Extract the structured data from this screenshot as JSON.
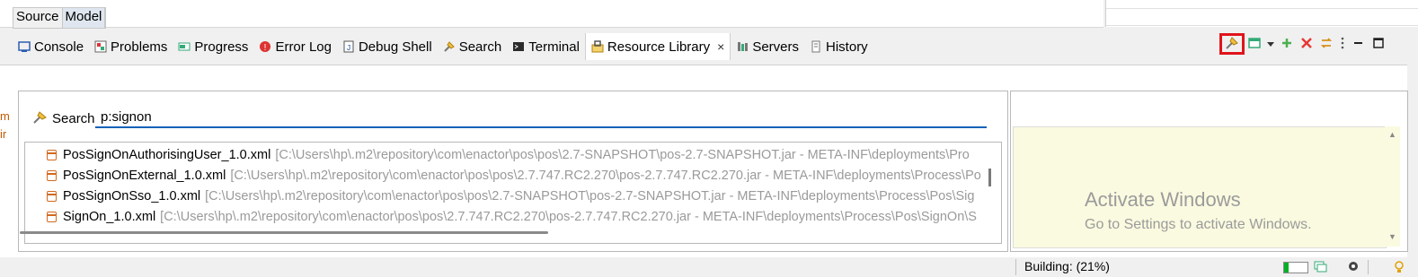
{
  "editor_tabs": {
    "source": "Source",
    "model": "Model"
  },
  "view_tabs": [
    {
      "label": "Console",
      "icon": "console-icon"
    },
    {
      "label": "Problems",
      "icon": "problems-icon"
    },
    {
      "label": "Progress",
      "icon": "progress-icon"
    },
    {
      "label": "Error Log",
      "icon": "error-log-icon"
    },
    {
      "label": "Debug Shell",
      "icon": "debug-shell-icon"
    },
    {
      "label": "Search",
      "icon": "search-icon"
    },
    {
      "label": "Terminal",
      "icon": "terminal-icon"
    },
    {
      "label": "Resource Library",
      "icon": "resource-library-icon",
      "active": true,
      "close": "×"
    },
    {
      "label": "Servers",
      "icon": "servers-icon"
    },
    {
      "label": "History",
      "icon": "history-icon"
    }
  ],
  "toolbar": {
    "buttons": [
      "resource-search-icon",
      "new-window-icon",
      "chevron-down-icon",
      "add-icon",
      "remove-icon",
      "swap-icon",
      "more-icon",
      "minimize-icon",
      "maximize-icon"
    ],
    "highlight_color": "#e0141b"
  },
  "search": {
    "label": "Search",
    "value": "p:signon"
  },
  "results": [
    {
      "name": "PosSignOnAuthorisingUser_1.0.xml",
      "path": "[C:\\Users\\hp\\.m2\\repository\\com\\enactor\\pos\\pos\\2.7-SNAPSHOT\\pos-2.7-SNAPSHOT.jar - META-INF\\deployments\\Pro"
    },
    {
      "name": "PosSignOnExternal_1.0.xml",
      "path": "[C:\\Users\\hp\\.m2\\repository\\com\\enactor\\pos\\pos\\2.7.747.RC2.270\\pos-2.7.747.RC2.270.jar - META-INF\\deployments\\Process\\Po"
    },
    {
      "name": "PosSignOnSso_1.0.xml",
      "path": "[C:\\Users\\hp\\.m2\\repository\\com\\enactor\\pos\\pos\\2.7-SNAPSHOT\\pos-2.7-SNAPSHOT.jar - META-INF\\deployments\\Process\\Pos\\Sig"
    },
    {
      "name": "SignOn_1.0.xml",
      "path": "[C:\\Users\\hp\\.m2\\repository\\com\\enactor\\pos\\pos\\2.7.747.RC2.270\\pos-2.7.747.RC2.270.jar - META-INF\\deployments\\Process\\Pos\\SignOn\\S"
    }
  ],
  "watermark": {
    "title": "Activate Windows",
    "subtitle": "Go to Settings to activate Windows."
  },
  "edge_fragment": {
    "line1": "m",
    "line2": "ir"
  },
  "status": {
    "building": "Building: (21%)",
    "progress_fraction": 0.21,
    "progress_color": "#06b025"
  }
}
